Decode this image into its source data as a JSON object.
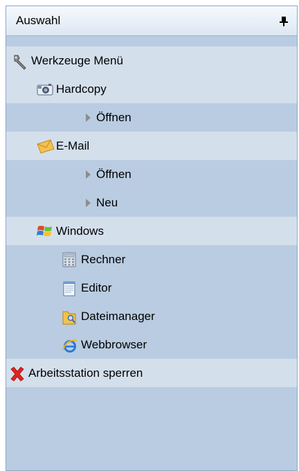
{
  "panel": {
    "title": "Auswahl",
    "pin_icon": "pin-icon"
  },
  "tree": {
    "root": {
      "label": "Werkzeuge Menü",
      "icon": "wrench-icon"
    },
    "hardcopy": {
      "label": "Hardcopy",
      "icon": "camera-icon",
      "items": [
        {
          "label": "Öffnen",
          "icon": "triangle-right-icon"
        }
      ]
    },
    "email": {
      "label": "E-Mail",
      "icon": "envelope-icon",
      "items": [
        {
          "label": "Öffnen",
          "icon": "triangle-right-icon"
        },
        {
          "label": "Neu",
          "icon": "triangle-right-icon"
        }
      ]
    },
    "windows": {
      "label": "Windows",
      "icon": "windows-logo-icon",
      "items": [
        {
          "label": "Rechner",
          "icon": "calculator-icon"
        },
        {
          "label": "Editor",
          "icon": "notepad-icon"
        },
        {
          "label": "Dateimanager",
          "icon": "folder-explorer-icon"
        },
        {
          "label": "Webbrowser",
          "icon": "internet-explorer-icon"
        }
      ]
    },
    "lock": {
      "label": "Arbeitsstation sperren",
      "icon": "red-x-icon"
    }
  },
  "colors": {
    "panel_bg": "#b9cce1",
    "band_bg": "#d4dfec",
    "header_bg": "#e8eff8",
    "border": "#8ea6c6"
  }
}
